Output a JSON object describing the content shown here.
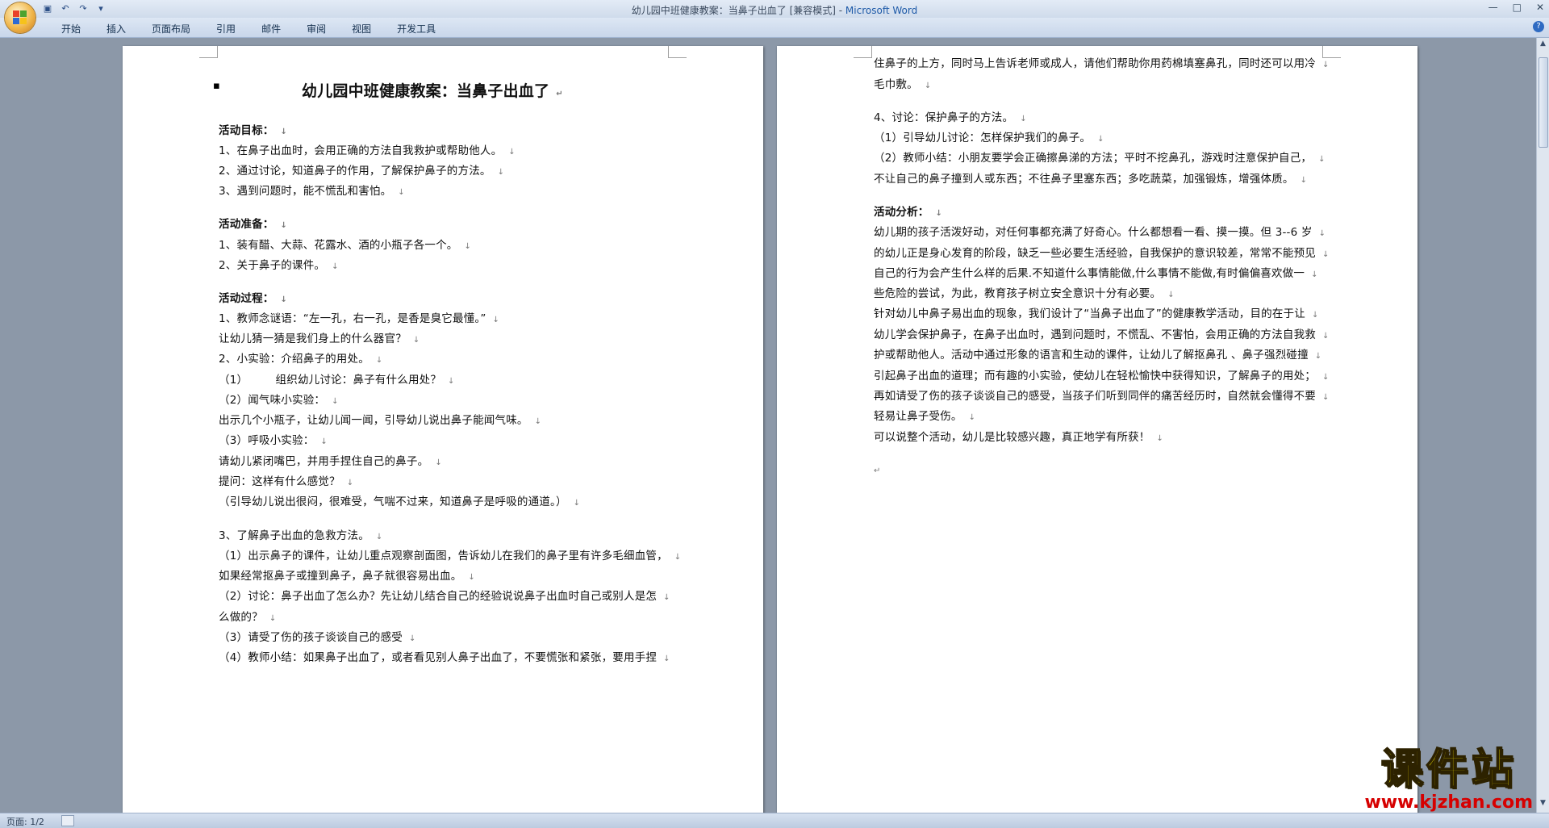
{
  "window": {
    "title": "幼儿园中班健康教案：当鼻子出血了 [兼容模式] - ",
    "app_name": "Microsoft Word",
    "min": "—",
    "max": "□",
    "close": "✕"
  },
  "ribbon": {
    "tabs": [
      "开始",
      "插入",
      "页面布局",
      "引用",
      "邮件",
      "审阅",
      "视图",
      "开发工具"
    ],
    "help": "?"
  },
  "page1": {
    "title": "幼儿园中班健康教案：当鼻子出血了",
    "lines": [
      {
        "text": "活动目标：",
        "bold": true
      },
      {
        "text": "1、在鼻子出血时，会用正确的方法自我救护或帮助他人。",
        "bold": false
      },
      {
        "text": "2、通过讨论，知道鼻子的作用，了解保护鼻子的方法。",
        "bold": false
      },
      {
        "text": "3、遇到问题时，能不慌乱和害怕。",
        "bold": false
      },
      {
        "text": "活动准备：",
        "bold": true
      },
      {
        "text": "1、装有醋、大蒜、花露水、酒的小瓶子各一个。",
        "bold": false
      },
      {
        "text": "2、关于鼻子的课件。",
        "bold": false
      },
      {
        "text": "活动过程：",
        "bold": true
      },
      {
        "text": "1、教师念谜语：“左一孔，右一孔，是香是臭它最懂。”",
        "bold": false
      },
      {
        "text": "让幼儿猜一猜是我们身上的什么器官？",
        "bold": false
      },
      {
        "text": "2、小实验：介绍鼻子的用处。",
        "bold": false
      },
      {
        "text": "（1）　　　组织幼儿讨论：鼻子有什么用处？",
        "bold": false
      },
      {
        "text": "（2）闻气味小实验：",
        "bold": false
      },
      {
        "text": "出示几个小瓶子，让幼儿闻一闻，引导幼儿说出鼻子能闻气味。",
        "bold": false
      },
      {
        "text": "（3）呼吸小实验：",
        "bold": false
      },
      {
        "text": "请幼儿紧闭嘴巴，并用手捏住自己的鼻子。",
        "bold": false
      },
      {
        "text": "提问：这样有什么感觉？",
        "bold": false
      },
      {
        "text": "（引导幼儿说出很闷，很难受，气喘不过来，知道鼻子是呼吸的通道。）",
        "bold": false
      },
      {
        "text": "3、了解鼻子出血的急救方法。",
        "bold": false
      },
      {
        "text": "（1）出示鼻子的课件，让幼儿重点观察剖面图，告诉幼儿在我们的鼻子里有许多毛细血管，",
        "bold": false
      },
      {
        "text": "如果经常抠鼻子或撞到鼻子，鼻子就很容易出血。",
        "bold": false
      },
      {
        "text": "（2）讨论：鼻子出血了怎么办？先让幼儿结合自己的经验说说鼻子出血时自己或别人是怎",
        "bold": false
      },
      {
        "text": "么做的？",
        "bold": false
      },
      {
        "text": "（3）请受了伤的孩子谈谈自己的感受",
        "bold": false
      },
      {
        "text": "（4）教师小结：如果鼻子出血了，或者看见别人鼻子出血了，不要慌张和紧张，要用手捏",
        "bold": false
      }
    ]
  },
  "page2": {
    "lines": [
      {
        "text": "住鼻子的上方，同时马上告诉老师或成人，请他们帮助你用药棉填塞鼻孔，同时还可以用冷",
        "bold": false
      },
      {
        "text": "毛巾敷。",
        "bold": false
      },
      {
        "text": "4、讨论：保护鼻子的方法。",
        "bold": false
      },
      {
        "text": "（1）引导幼儿讨论：怎样保护我们的鼻子。",
        "bold": false
      },
      {
        "text": "（2）教师小结：小朋友要学会正确擦鼻涕的方法；平时不挖鼻孔，游戏时注意保护自己，",
        "bold": false
      },
      {
        "text": "不让自己的鼻子撞到人或东西；不往鼻子里塞东西；多吃蔬菜，加强锻炼，增强体质。",
        "bold": false
      },
      {
        "text": "活动分析：",
        "bold": true
      },
      {
        "text": "幼儿期的孩子活泼好动，对任何事都充满了好奇心。什么都想看一看、摸一摸。但 3--6 岁",
        "bold": false
      },
      {
        "text": "的幼儿正是身心发育的阶段，缺乏一些必要生活经验，自我保护的意识较差，常常不能预见",
        "bold": false
      },
      {
        "text": "自己的行为会产生什么样的后果.不知道什么事情能做,什么事情不能做,有时偏偏喜欢做一",
        "bold": false
      },
      {
        "text": "些危险的尝试，为此，教育孩子树立安全意识十分有必要。",
        "bold": false
      },
      {
        "text": "针对幼儿中鼻子易出血的现象，我们设计了“当鼻子出血了”的健康教学活动，目的在于让",
        "bold": false
      },
      {
        "text": "幼儿学会保护鼻子，在鼻子出血时，遇到问题时，不慌乱、不害怕，会用正确的方法自我救",
        "bold": false
      },
      {
        "text": "护或帮助他人。活动中通过形象的语言和生动的课件，让幼儿了解抠鼻孔 、鼻子强烈碰撞",
        "bold": false
      },
      {
        "text": "引起鼻子出血的道理；而有趣的小实验，使幼儿在轻松愉快中获得知识，了解鼻子的用处；",
        "bold": false
      },
      {
        "text": "再如请受了伤的孩子谈谈自己的感受，当孩子们听到同伴的痛苦经历时，自然就会懂得不要",
        "bold": false
      },
      {
        "text": "轻易让鼻子受伤。",
        "bold": false
      },
      {
        "text": "可以说整个活动，幼儿是比较感兴趣，真正地学有所获！",
        "bold": false
      }
    ]
  },
  "marks": {
    "para": "↓",
    "end": "↵"
  },
  "status": {
    "page": "页面: 1/2"
  },
  "watermark": {
    "text": "课件站",
    "url": "www.kjzhan.com"
  }
}
